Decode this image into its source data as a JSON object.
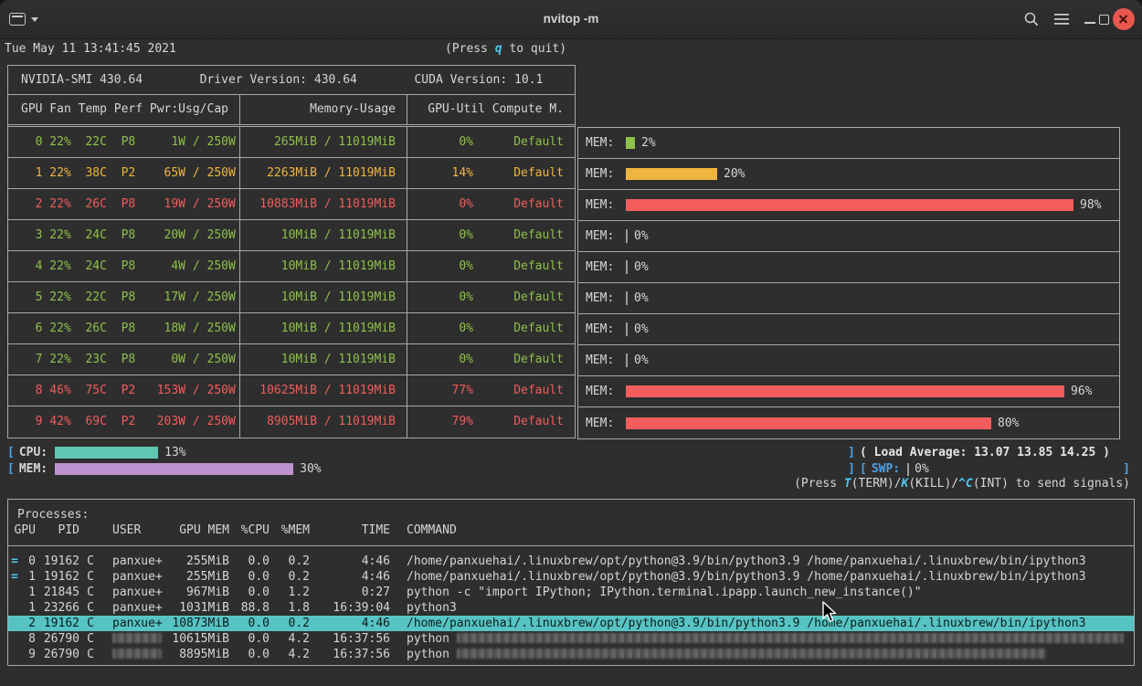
{
  "colors": {
    "green": "#8fc04a",
    "yellow": "#f0b440",
    "red": "#f25c5c",
    "key_cyan": "#4ec9ef",
    "bracket_blue": "#4aa3e8",
    "cpu_bar": "#5ec6b2",
    "mem_bar": "#bd92ce",
    "selected_bg": "#57c3c3",
    "close_button": "#e9574e"
  },
  "titlebar": {
    "title": "nvitop -m"
  },
  "statusline": {
    "datetime": "Tue May 11 13:41:45 2021",
    "quit_pre": "(Press ",
    "quit_key": "q",
    "quit_post": " to quit)"
  },
  "smi": {
    "banner": "NVIDIA-SMI 430.64        Driver Version: 430.64        CUDA Version: 10.1",
    "columns": {
      "info": "GPU Fan Temp Perf Pwr:Usg/Cap",
      "memory": "Memory-Usage",
      "util_compute": "GPU-Util Compute M."
    },
    "mem_label": "MEM:",
    "gpus": [
      {
        "info": "  0 22%  22C  P8     1W / 250W",
        "memory": "265MiB / 11019MiB",
        "util": "0%",
        "compute": "Default",
        "mem_pct": 2,
        "mem_pct_label": "2%",
        "color": "green"
      },
      {
        "info": "  1 22%  38C  P2    65W / 250W",
        "memory": "2263MiB / 11019MiB",
        "util": "14%",
        "compute": "Default",
        "mem_pct": 20,
        "mem_pct_label": "20%",
        "color": "yellow"
      },
      {
        "info": "  2 22%  26C  P8    19W / 250W",
        "memory": "10883MiB / 11019MiB",
        "util": "0%",
        "compute": "Default",
        "mem_pct": 98,
        "mem_pct_label": "98%",
        "color": "red"
      },
      {
        "info": "  3 22%  24C  P8    20W / 250W",
        "memory": "10MiB / 11019MiB",
        "util": "0%",
        "compute": "Default",
        "mem_pct": 0,
        "mem_pct_label": "0%",
        "color": "green"
      },
      {
        "info": "  4 22%  24C  P8     4W / 250W",
        "memory": "10MiB / 11019MiB",
        "util": "0%",
        "compute": "Default",
        "mem_pct": 0,
        "mem_pct_label": "0%",
        "color": "green"
      },
      {
        "info": "  5 22%  22C  P8    17W / 250W",
        "memory": "10MiB / 11019MiB",
        "util": "0%",
        "compute": "Default",
        "mem_pct": 0,
        "mem_pct_label": "0%",
        "color": "green"
      },
      {
        "info": "  6 22%  26C  P8    18W / 250W",
        "memory": "10MiB / 11019MiB",
        "util": "0%",
        "compute": "Default",
        "mem_pct": 0,
        "mem_pct_label": "0%",
        "color": "green"
      },
      {
        "info": "  7 22%  23C  P8     0W / 250W",
        "memory": "10MiB / 11019MiB",
        "util": "0%",
        "compute": "Default",
        "mem_pct": 0,
        "mem_pct_label": "0%",
        "color": "green"
      },
      {
        "info": "  8 46%  75C  P2   153W / 250W",
        "memory": "10625MiB / 11019MiB",
        "util": "77%",
        "compute": "Default",
        "mem_pct": 96,
        "mem_pct_label": "96%",
        "color": "red"
      },
      {
        "info": "  9 42%  69C  P2   203W / 250W",
        "memory": "8905MiB / 11019MiB",
        "util": "79%",
        "compute": "Default",
        "mem_pct": 80,
        "mem_pct_label": "80%",
        "color": "red"
      }
    ]
  },
  "meters": {
    "bracket_l": "[",
    "bracket_r": "]",
    "cpu": {
      "label": "CPU:",
      "pct": 13,
      "pct_label": "13%"
    },
    "mem": {
      "label": "MEM:",
      "pct": 30,
      "pct_label": "30%"
    },
    "swp": {
      "label": "SWP:",
      "pct": 0,
      "pct_label": "0%"
    },
    "load_average": "( Load Average: 13.07 13.85 14.25 )"
  },
  "signals": {
    "pre": "(Press ",
    "term_key": "T",
    "term_post": "(TERM)/",
    "kill_key": "K",
    "kill_post": "(KILL)/",
    "int_key": "^C",
    "int_post": "(INT) to send signals)"
  },
  "processes": {
    "title": "Processes:",
    "headers": {
      "gpu": "GPU",
      "pid": "PID",
      "user": "USER",
      "gpu_mem": "GPU MEM",
      "cpu": "%CPU",
      "mem": "%MEM",
      "time": "TIME",
      "command": "COMMAND"
    },
    "rows": [
      {
        "mark": "=",
        "gpu": "0",
        "pid": "19162",
        "type": "C",
        "user": "panxue+",
        "gpu_mem": "255MiB",
        "cpu": "0.0",
        "mem": "0.2",
        "time": "4:46",
        "command": "/home/panxuehai/.linuxbrew/opt/python@3.9/bin/python3.9 /home/panxuehai/.linuxbrew/bin/ipython3"
      },
      {
        "mark": "=",
        "gpu": "1",
        "pid": "19162",
        "type": "C",
        "user": "panxue+",
        "gpu_mem": "255MiB",
        "cpu": "0.0",
        "mem": "0.2",
        "time": "4:46",
        "command": "/home/panxuehai/.linuxbrew/opt/python@3.9/bin/python3.9 /home/panxuehai/.linuxbrew/bin/ipython3"
      },
      {
        "gpu": "1",
        "pid": "21845",
        "type": "C",
        "user": "panxue+",
        "gpu_mem": "967MiB",
        "cpu": "0.0",
        "mem": "1.2",
        "time": "0:27",
        "command": "python -c \"import IPython; IPython.terminal.ipapp.launch_new_instance()\""
      },
      {
        "gpu": "1",
        "pid": "23266",
        "type": "C",
        "user": "panxue+",
        "gpu_mem": "1031MiB",
        "cpu": "88.8",
        "mem": "1.8",
        "time": "16:39:04",
        "command": "python3"
      },
      {
        "gpu": "2",
        "pid": "19162",
        "type": "C",
        "user": "panxue+",
        "gpu_mem": "10873MiB",
        "cpu": "0.0",
        "mem": "0.2",
        "time": "4:46",
        "command": "/home/panxuehai/.linuxbrew/opt/python@3.9/bin/python3.9 /home/panxuehai/.linuxbrew/bin/ipython3",
        "selected": true
      },
      {
        "gpu": "8",
        "pid": "26790",
        "type": "C",
        "user_redacted": true,
        "gpu_mem": "10615MiB",
        "cpu": "0.0",
        "mem": "4.2",
        "time": "16:37:56",
        "command": "python ",
        "command_redacted_width": 730
      },
      {
        "gpu": "9",
        "pid": "26790",
        "type": "C",
        "user_redacted": true,
        "gpu_mem": "8895MiB",
        "cpu": "0.0",
        "mem": "4.2",
        "time": "16:37:56",
        "command": "python ",
        "command_redacted_width": 645
      }
    ]
  }
}
